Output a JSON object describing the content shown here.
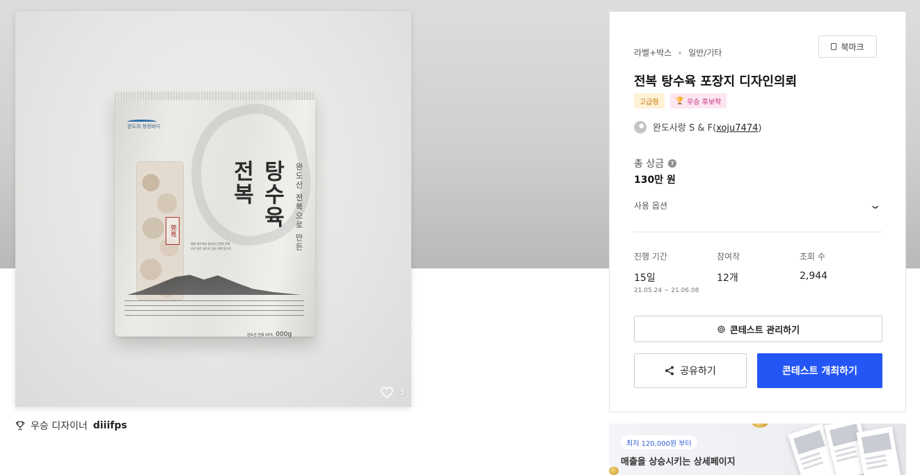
{
  "product_image": {
    "pouch": {
      "logo": "완도의 청정바다",
      "title": "탕수육\n전복",
      "stamp": "莞島",
      "subtitle": "완도산 전복으로 만든",
      "description": "청정 완도에서 길러낸 건강한 전복으로 만든 완도의 깊은 전복 탕수육",
      "weight_prefix": "완도산 전복 00%",
      "weight": "000g"
    },
    "likes": "3"
  },
  "winner": {
    "prefix": "우승 디자이너",
    "name": "diiifps"
  },
  "panel": {
    "category_main": "라벨+박스",
    "category_sub": "일반/기타",
    "bookmark_label": "북마크",
    "title": "전복 탕수육 포장지 디자인의뢰",
    "badges": {
      "premium": "고급형",
      "candidate": "우승 후보작"
    },
    "host_name": "완도사랑 S & F",
    "host_handle": "xoju7474",
    "prize_label": "총 상금",
    "prize_value": "130만 원",
    "options_label": "사용 옵션",
    "stats": {
      "period_label": "진행 기간",
      "period_value": "15일",
      "period_range": "21.05.24 ~ 21.06.08",
      "entries_label": "참여작",
      "entries_value": "12개",
      "views_label": "조회 수",
      "views_value": "2,944"
    },
    "manage_button": "콘테스트 관리하기",
    "share_button": "공유하기",
    "host_button": "콘테스트 개최하기"
  },
  "promo": {
    "pill": "최저 120,000원 부터",
    "text": "매출을 상승시키는 상세페이지"
  },
  "colors": {
    "primary": "#2456f5",
    "premium_bg": "#fff1d6",
    "premium_text": "#c47a00",
    "candidate_bg": "#fde6f1",
    "candidate_text": "#c3287a"
  }
}
